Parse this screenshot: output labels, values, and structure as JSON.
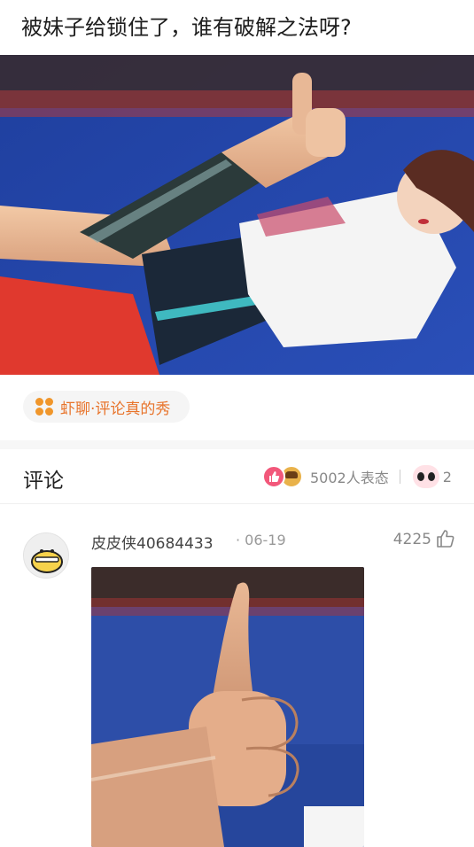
{
  "post": {
    "title": "被妹子给锁住了，谁有破解之法呀?"
  },
  "topic": {
    "icon": "clover-icon",
    "label": "虾聊·评论真的秀",
    "accent_color": "#e8742b"
  },
  "comments_section": {
    "title": "评论",
    "reactions": {
      "count_label": "5002人表态",
      "icons": [
        "thumbs-up-reaction-icon",
        "emoji-reaction-icon",
        "eyes-reaction-icon"
      ],
      "overflow_text": "2",
      "like_color": "#f2577a"
    }
  },
  "comment": {
    "author": "皮皮侠40684433",
    "date": "· 06-19",
    "likes": "4225",
    "like_icon": "thumbs-up-outline-icon"
  }
}
